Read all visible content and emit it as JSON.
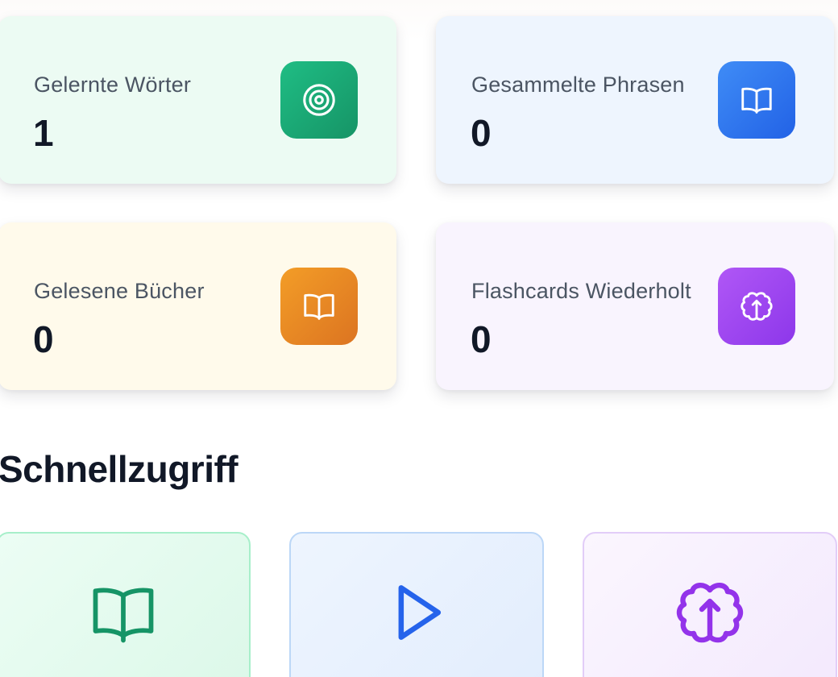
{
  "stats": [
    {
      "label": "Gelernte Wörter",
      "value": "1",
      "icon": "target-icon",
      "color": "#1fbd84"
    },
    {
      "label": "Gesammelte Phrasen",
      "value": "0",
      "icon": "book-open-icon",
      "color": "#3f8cf6"
    },
    {
      "label": "Gelesene Bücher",
      "value": "0",
      "icon": "book-open-icon",
      "color": "#f39d27"
    },
    {
      "label": "Flashcards Wiederholt",
      "value": "0",
      "icon": "brain-icon",
      "color": "#b057f6"
    }
  ],
  "quick_access": {
    "title": "Schnellzugriff",
    "items": [
      {
        "icon": "book-open-icon",
        "color": "#169466"
      },
      {
        "icon": "play-icon",
        "color": "#2563eb"
      },
      {
        "icon": "brain-icon",
        "color": "#9333ea"
      }
    ]
  }
}
